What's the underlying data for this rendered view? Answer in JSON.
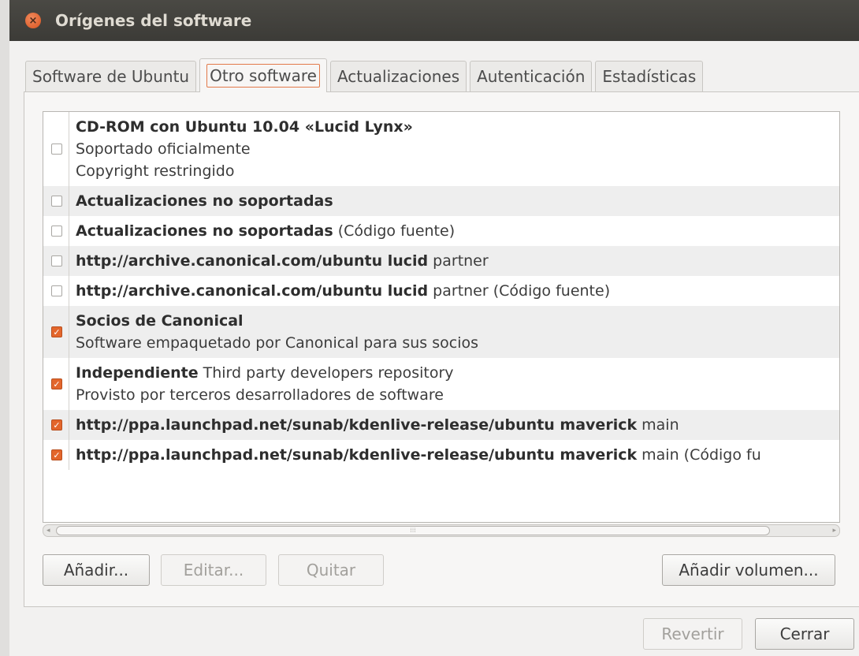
{
  "window": {
    "title": "Orígenes del software"
  },
  "tabs": [
    {
      "label": "Software de Ubuntu"
    },
    {
      "label": "Otro software"
    },
    {
      "label": "Actualizaciones"
    },
    {
      "label": "Autenticación"
    },
    {
      "label": "Estadísticas"
    }
  ],
  "sources": [
    {
      "checked": false,
      "bold": "CD-ROM con Ubuntu 10.04 «Lucid Lynx»",
      "normal": "",
      "line2": "Soportado oficialmente",
      "line3": "Copyright restringido"
    },
    {
      "checked": false,
      "bold": "Actualizaciones no soportadas",
      "normal": ""
    },
    {
      "checked": false,
      "bold": "Actualizaciones no soportadas",
      "normal": " (Código fuente)"
    },
    {
      "checked": false,
      "bold": "http://archive.canonical.com/ubuntu lucid",
      "normal": " partner"
    },
    {
      "checked": false,
      "bold": "http://archive.canonical.com/ubuntu lucid",
      "normal": " partner (Código fuente)"
    },
    {
      "checked": true,
      "bold": "Socios de Canonical",
      "normal": "",
      "line2": "Software empaquetado por Canonical para sus socios"
    },
    {
      "checked": true,
      "bold": "Independiente",
      "normal": " Third party developers repository",
      "line2": "Provisto por terceros desarrolladores de software"
    },
    {
      "checked": true,
      "bold": "http://ppa.launchpad.net/sunab/kdenlive-release/ubuntu maverick",
      "normal": " main"
    },
    {
      "checked": true,
      "bold": "http://ppa.launchpad.net/sunab/kdenlive-release/ubuntu maverick",
      "normal": " main (Código fu"
    }
  ],
  "panel_buttons": {
    "add": "Añadir...",
    "edit": "Editar...",
    "remove": "Quitar",
    "add_volume": "Añadir volumen..."
  },
  "dialog_buttons": {
    "revert": "Revertir",
    "close": "Cerrar"
  },
  "colors": {
    "accent": "#e3662c",
    "titlebar": "#3c3b37"
  },
  "icons": {
    "close": "close-icon",
    "check": "checkmark-icon"
  }
}
